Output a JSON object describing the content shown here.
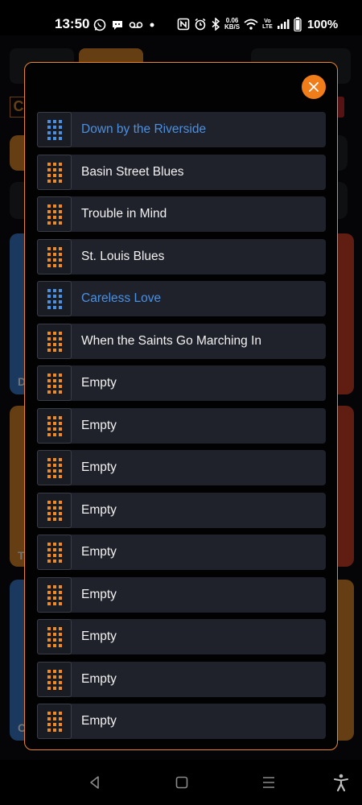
{
  "status_bar": {
    "time": "13:50",
    "net_speed_value": "0.06",
    "net_speed_unit": "KB/S",
    "volte_top": "Vo",
    "volte_bottom": "LTE",
    "battery_percent": "100%"
  },
  "background": {
    "visible_letters": [
      "C",
      "D",
      "T",
      "C"
    ]
  },
  "modal": {
    "close_icon": "close-icon",
    "accent_color": "#e9852a",
    "items": [
      {
        "label": "Down by the Riverside",
        "active": true
      },
      {
        "label": "Basin Street Blues",
        "active": false
      },
      {
        "label": "Trouble in Mind",
        "active": false
      },
      {
        "label": "St. Louis Blues",
        "active": false
      },
      {
        "label": "Careless Love",
        "active": true
      },
      {
        "label": "When the Saints Go Marching In",
        "active": false
      },
      {
        "label": "Empty",
        "active": false
      },
      {
        "label": "Empty",
        "active": false
      },
      {
        "label": "Empty",
        "active": false
      },
      {
        "label": "Empty",
        "active": false
      },
      {
        "label": "Empty",
        "active": false
      },
      {
        "label": "Empty",
        "active": false
      },
      {
        "label": "Empty",
        "active": false
      },
      {
        "label": "Empty",
        "active": false
      },
      {
        "label": "Empty",
        "active": false
      }
    ]
  },
  "colors": {
    "active_text": "#4a90e2",
    "active_dots": "#4a90e2",
    "inactive_dots": "#f08a24",
    "close_button": "#f07c1a"
  },
  "nav_bar": {
    "back_icon": "back-triangle-icon",
    "home_icon": "home-square-icon",
    "recents_icon": "recents-lines-icon",
    "accessibility_icon": "accessibility-icon"
  }
}
